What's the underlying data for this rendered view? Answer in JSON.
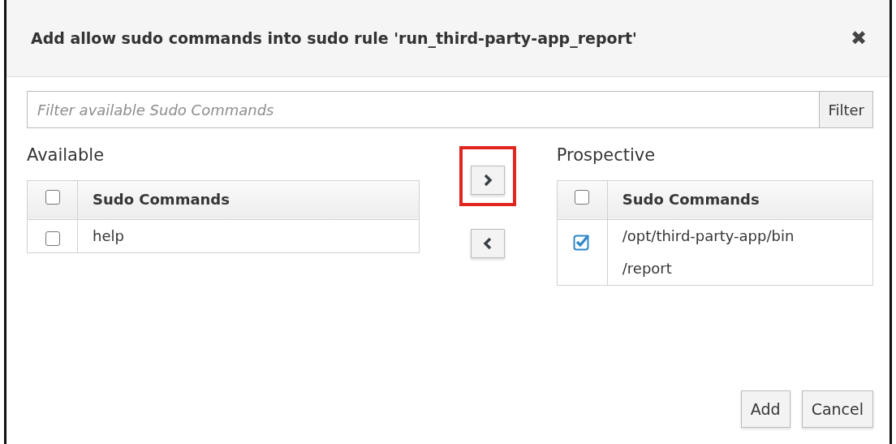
{
  "dialog": {
    "title": "Add allow sudo commands into sudo rule 'run_third-party-app_report'",
    "close": "✖"
  },
  "filter": {
    "placeholder": "Filter available Sudo Commands",
    "button": "Filter"
  },
  "available": {
    "label": "Available",
    "header": {
      "label": "Sudo Commands",
      "checked": false
    },
    "rows": [
      {
        "label": "help",
        "checked": false
      }
    ]
  },
  "move_buttons": [
    {
      "kind": "right",
      "highlighted": true
    },
    {
      "kind": "left",
      "highlighted": false
    }
  ],
  "prospective": {
    "label": "Prospective",
    "header": {
      "label": "Sudo Commands",
      "checked": false
    },
    "rows": [
      {
        "label": "/opt/third-party-app/bin\n/report",
        "checked": true
      }
    ]
  },
  "buttons": [
    "Add",
    "Cancel"
  ]
}
